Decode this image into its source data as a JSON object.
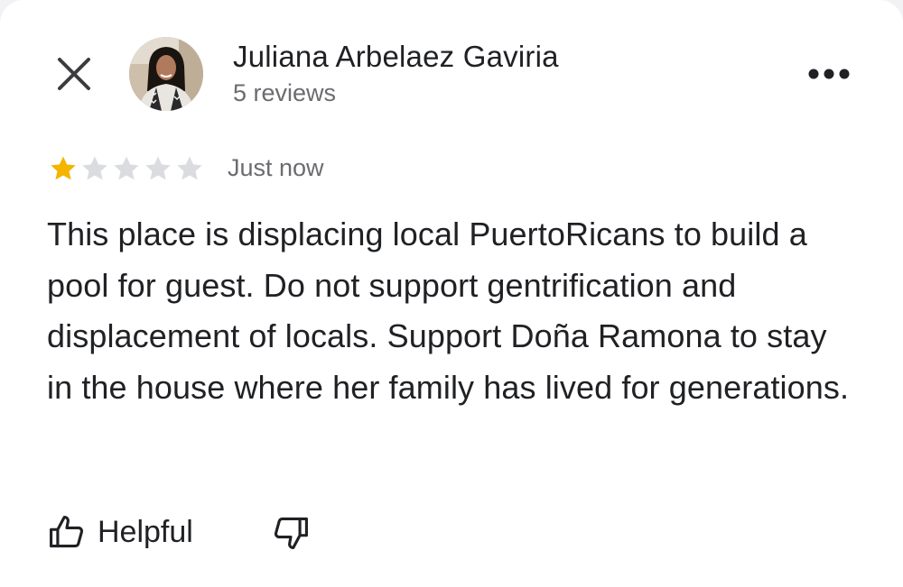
{
  "reviewer": {
    "name": "Juliana Arbelaez Gaviria",
    "reviews_count": "5 reviews",
    "avatar_icon": "avatar-photo"
  },
  "review": {
    "rating": 1,
    "max_rating": 5,
    "timestamp": "Just now",
    "text": "This place is displacing local PuertoRicans to build a pool for guest. Do not support gentrification and displacement of locals. Support Doña Ramona to stay in the house where her family has lived for generations."
  },
  "actions": {
    "helpful_label": "Helpful",
    "close_icon": "close-icon",
    "more_icon": "more-horizontal-icon",
    "thumbs_up_icon": "thumbs-up-icon",
    "thumbs_down_icon": "thumbs-down-icon"
  },
  "colors": {
    "star_filled": "#F4B400",
    "star_empty": "#DADCE0",
    "text_primary": "#202124",
    "text_secondary": "#6B6B70"
  }
}
